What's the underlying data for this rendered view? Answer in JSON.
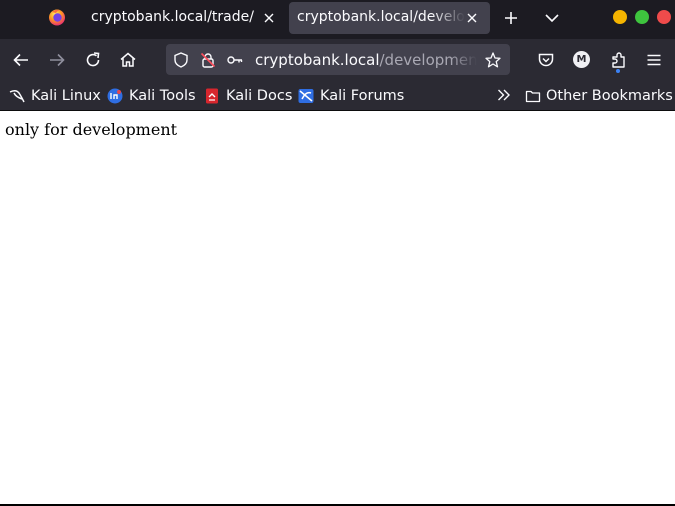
{
  "browser": {
    "tabs": [
      {
        "title": "cryptobank.local/trade/",
        "active": true
      },
      {
        "title": "cryptobank.local/development",
        "active": false
      }
    ]
  },
  "navbar": {
    "url_host": "cryptobank.local",
    "url_path": "/development/"
  },
  "bookmarks": {
    "items": [
      {
        "label": "Kali Linux",
        "icon": "kali-linux-icon"
      },
      {
        "label": "Kali Tools",
        "icon": "kali-tools-icon"
      },
      {
        "label": "Kali Docs",
        "icon": "kali-docs-icon"
      },
      {
        "label": "Kali Forums",
        "icon": "kali-forums-icon"
      }
    ],
    "other_label": "Other Bookmarks"
  },
  "page": {
    "body_text": "only for development"
  },
  "account": {
    "avatar_letter": "M"
  },
  "colors": {
    "tabbar_bg": "#1c1b22",
    "toolbar_bg": "#2b2a33",
    "urlbar_bg": "#42414d",
    "text": "#fbfbfe",
    "muted_text": "#a9a8b3"
  }
}
